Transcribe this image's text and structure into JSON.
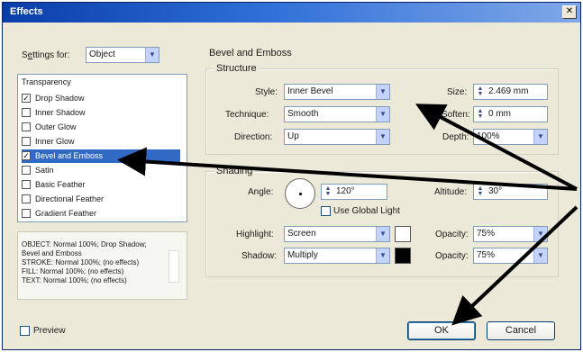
{
  "window": {
    "title": "Effects",
    "close_glyph": "✕"
  },
  "settings": {
    "label_pre": "S",
    "label_ul": "e",
    "label_post": "ttings for:",
    "value": "Object"
  },
  "list": {
    "header": "Transparency",
    "items": [
      {
        "label": "Drop Shadow",
        "checked": true,
        "selected": false
      },
      {
        "label": "Inner Shadow",
        "checked": false,
        "selected": false
      },
      {
        "label": "Outer Glow",
        "checked": false,
        "selected": false
      },
      {
        "label": "Inner Glow",
        "checked": false,
        "selected": false
      },
      {
        "label": "Bevel and Emboss",
        "checked": true,
        "selected": true
      },
      {
        "label": "Satin",
        "checked": false,
        "selected": false
      },
      {
        "label": "Basic Feather",
        "checked": false,
        "selected": false
      },
      {
        "label": "Directional Feather",
        "checked": false,
        "selected": false
      },
      {
        "label": "Gradient Feather",
        "checked": false,
        "selected": false
      }
    ]
  },
  "summary": {
    "lines": [
      "OBJECT: Normal 100%; Drop Shadow;",
      "Bevel and Emboss",
      "STROKE: Normal 100%; (no effects)",
      "FILL: Normal 100%; (no effects)",
      "TEXT: Normal 100%; (no effects)"
    ]
  },
  "panel": {
    "title": "Bevel and Emboss"
  },
  "structure": {
    "title": "Structure",
    "style_label": "Style:",
    "style_value": "Inner Bevel",
    "technique_label": "Technique:",
    "technique_value": "Smooth",
    "direction_label": "Direction:",
    "direction_value": "Up",
    "size_label": "Size:",
    "size_value": "2.469 mm",
    "soften_label": "Soften:",
    "soften_value": "0 mm",
    "depth_label": "Depth:",
    "depth_value": "100%"
  },
  "shading": {
    "title": "Shading",
    "angle_label": "Angle:",
    "angle_value": "120°",
    "altitude_label": "Altitude:",
    "altitude_value": "30°",
    "global_light_label": "Use Global Light",
    "highlight_label": "Highlight:",
    "highlight_value": "Screen",
    "shadow_label": "Shadow:",
    "shadow_value": "Multiply",
    "highlight_opacity_label": "Opacity:",
    "highlight_opacity_value": "75%",
    "shadow_opacity_label": "Opacity:",
    "shadow_opacity_value": "75%",
    "highlight_color": "#ffffff",
    "shadow_color": "#000000"
  },
  "footer": {
    "preview_label": "Preview",
    "ok_label": "OK",
    "cancel_label": "Cancel"
  },
  "annotations": {
    "arrow_color": "#000000"
  }
}
